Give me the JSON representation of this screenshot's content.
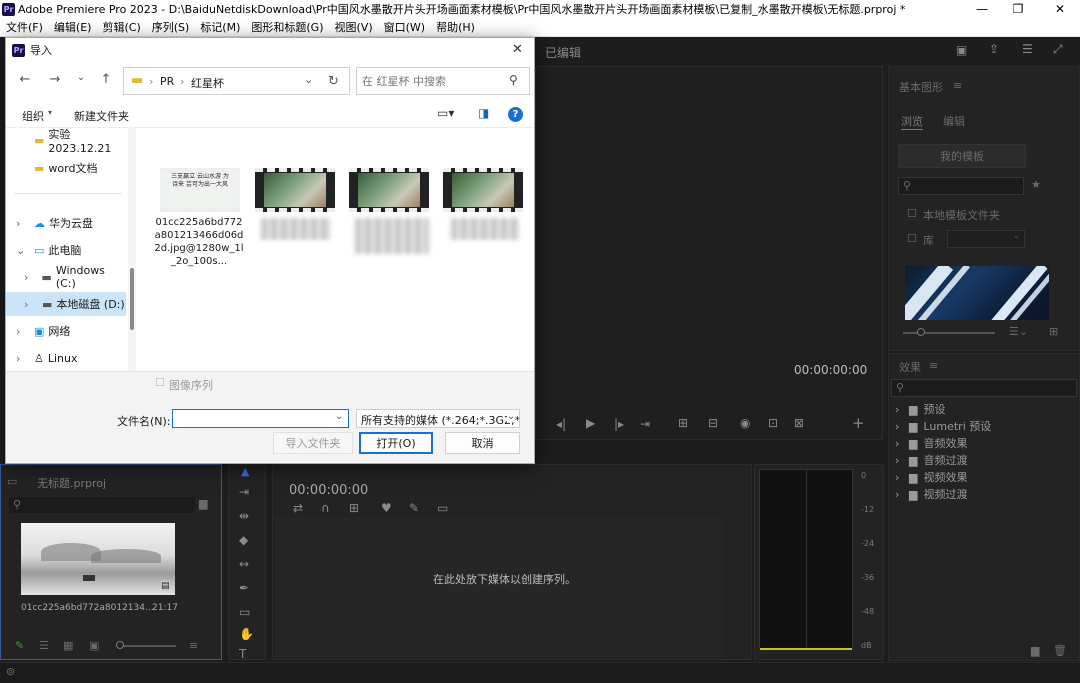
{
  "window": {
    "app_badge": "Pr",
    "title": "Adobe Premiere Pro 2023 - D:\\BaiduNetdiskDownload\\Pr中国风水墨散开片头开场画面素材模板\\Pr中国风水墨散开片头开场画面素材模板\\已复制_水墨散开模板\\无标题.prproj *",
    "minimize": "—",
    "maximize": "❐",
    "close": "✕"
  },
  "menu": [
    "文件(F)",
    "编辑(E)",
    "剪辑(C)",
    "序列(S)",
    "标记(M)",
    "图形和标题(G)",
    "视图(V)",
    "窗口(W)",
    "帮助(H)"
  ],
  "program": {
    "title": "已编辑",
    "timecode": "00:00:00:00"
  },
  "essential_graphics": {
    "title": "基本图形",
    "tab_browse": "浏览",
    "tab_edit": "编辑",
    "my_templates": "我的模板",
    "local_templates": "本地模板文件夹",
    "library": "库"
  },
  "effects": {
    "title": "效果",
    "items": [
      "预设",
      "Lumetri 预设",
      "音频效果",
      "音频过渡",
      "视频效果",
      "视频过渡"
    ]
  },
  "project": {
    "name": "无标题.prproj",
    "clip_name": "01cc225a6bd772a8012134...",
    "clip_duration": "21:17"
  },
  "timeline": {
    "timecode": "00:00:00:00",
    "empty_hint": "在此处放下媒体以创建序列。"
  },
  "meter": {
    "scale": [
      "0",
      "-12",
      "-24",
      "-36",
      "-48",
      "dB"
    ]
  },
  "dialog": {
    "app_badge": "Pr",
    "title": "导入",
    "breadcrumb": [
      "PR",
      "红星杯"
    ],
    "search_placeholder": "在 红星杯 中搜索",
    "organize": "组织",
    "new_folder": "新建文件夹",
    "tree": [
      "实验2023.12.21",
      "word文档",
      "华为云盘",
      "此电脑",
      "Windows (C:)",
      "本地磁盘 (D:)",
      "网络",
      "Linux"
    ],
    "file1_name": "01cc225a6bd772a801213466d06d2d.jpg@1280w_1l_2o_100s...",
    "file1_thumb_text": "三支羸立 云山水游 为诗来 芸可为出一大风",
    "image_sequence": "图像序列",
    "filename_label": "文件名(N):",
    "filename_value": "",
    "filter": "所有支持的媒体 (*.264;*.3G2;*.",
    "import_folder": "导入文件夹",
    "open": "打开(O)",
    "cancel": "取消"
  }
}
